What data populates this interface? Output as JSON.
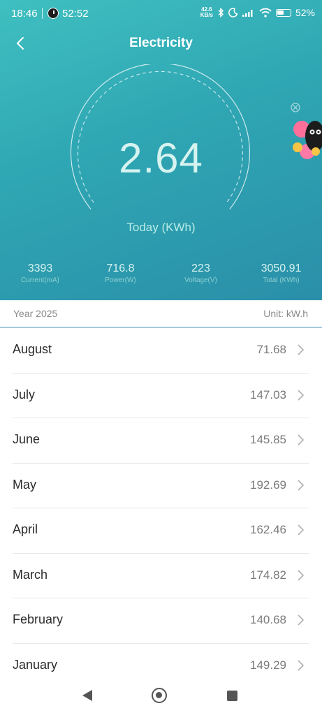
{
  "status": {
    "time": "18:46",
    "timer": "52:52",
    "netspeed_top": "42.6",
    "netspeed_bottom": "KB/s",
    "battery": "52%"
  },
  "header": {
    "title": "Electricity"
  },
  "today": {
    "value": "2.64",
    "label": "Today (KWh)"
  },
  "stats": [
    {
      "value": "3393",
      "label": "Current(mA)"
    },
    {
      "value": "716.8",
      "label": "Power(W)"
    },
    {
      "value": "223",
      "label": "Voltage(V)"
    },
    {
      "value": "3050.91",
      "label": "Total (KWh)"
    }
  ],
  "year_bar": {
    "year": "Year 2025",
    "unit": "Unit: kW.h"
  },
  "months": [
    {
      "name": "August",
      "value": "71.68"
    },
    {
      "name": "July",
      "value": "147.03"
    },
    {
      "name": "June",
      "value": "145.85"
    },
    {
      "name": "May",
      "value": "192.69"
    },
    {
      "name": "April",
      "value": "162.46"
    },
    {
      "name": "March",
      "value": "174.82"
    },
    {
      "name": "February",
      "value": "140.68"
    },
    {
      "name": "January",
      "value": "149.29"
    }
  ],
  "colors": {
    "gradient_start": "#3fbfc0",
    "gradient_end": "#2a8fa9",
    "divider_accent": "#3a8fb0"
  },
  "icons": {
    "back": "chevron-left-icon",
    "row": "chevron-right-icon",
    "nav": [
      "nav-back-icon",
      "nav-home-icon",
      "nav-recents-icon"
    ]
  }
}
